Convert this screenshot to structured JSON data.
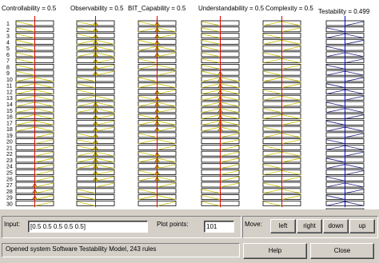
{
  "variables": [
    {
      "name": "Controllability",
      "value": "0.5"
    },
    {
      "name": "Observability",
      "value": "0.5"
    },
    {
      "name": "BIT_Capability",
      "value": "0.5"
    },
    {
      "name": "Understandability",
      "value": "0.5"
    },
    {
      "name": "Complexity",
      "value": "0.5"
    }
  ],
  "output": {
    "name": "Testability",
    "value": "0.499"
  },
  "rules": [
    "1",
    "2",
    "3",
    "4",
    "5",
    "6",
    "7",
    "8",
    "9",
    "10",
    "11",
    "12",
    "13",
    "14",
    "15",
    "16",
    "17",
    "18",
    "19",
    "20",
    "21",
    "22",
    "23",
    "24",
    "25",
    "26",
    "27",
    "28",
    "29",
    "30"
  ],
  "input": {
    "label": "Input:",
    "value": "[0.5 0.5 0.5 0.5 0.5]"
  },
  "plot_points": {
    "label": "Plot points:",
    "value": "101"
  },
  "move": {
    "label": "Move:",
    "buttons": [
      "left",
      "right",
      "down",
      "up"
    ]
  },
  "status_text": "Opened system Software Testability Model, 243 rules",
  "help_label": "Help",
  "close_label": "Close",
  "colors": {
    "fill": "#f0c000",
    "line": "#e00000",
    "output_line": "#0000d0"
  }
}
